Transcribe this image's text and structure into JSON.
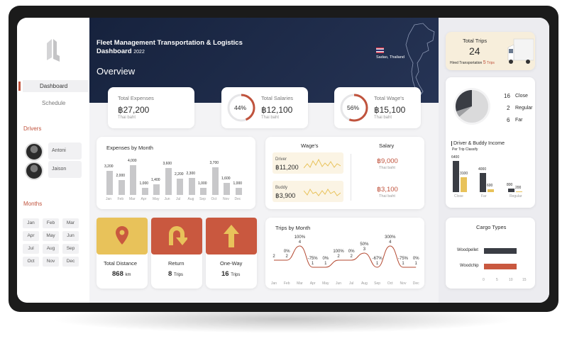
{
  "header": {
    "title": "Fleet Management Transportation & Logistics",
    "subtitle": "Dashboard",
    "year": "2022",
    "section": "Overview",
    "location": "Sadao, Thailand"
  },
  "nav": {
    "dashboard": "Dashboard",
    "schedule": "Schedule"
  },
  "drivers": {
    "title": "Drivers",
    "items": [
      "Antoni",
      "Jaison"
    ]
  },
  "months": {
    "title": "Months",
    "items": [
      "Jan",
      "Feb",
      "Mar",
      "Apr",
      "May",
      "Jun",
      "Jul",
      "Aug",
      "Sep",
      "Oct",
      "Nov",
      "Dec"
    ]
  },
  "kpi": {
    "expenses": {
      "label": "Total Expenses",
      "value": "฿27,200",
      "unit": "Thai baht"
    },
    "salaries": {
      "label": "Total Salaries",
      "value": "฿12,100",
      "unit": "Thai baht",
      "pct": "44%",
      "pct_value": 44
    },
    "wages": {
      "label": "Total Wage's",
      "value": "฿15,100",
      "unit": "Thai baht",
      "pct": "56%",
      "pct_value": 56
    }
  },
  "expenses_chart": {
    "title": "Expenses by Month",
    "categories": [
      "Jan",
      "Feb",
      "Mar",
      "Apr",
      "May",
      "Jun",
      "Jul",
      "Aug",
      "Sep",
      "Oct",
      "Nov",
      "Dec"
    ],
    "labels": [
      "3,200",
      "2,000",
      "4,000",
      "1,000",
      "1,400",
      "3,600",
      "2,200",
      "2,300",
      "1,000",
      "3,700",
      "1,600",
      "1,000"
    ],
    "values": [
      3200,
      2000,
      4000,
      1000,
      1400,
      3600,
      2200,
      2300,
      1000,
      3700,
      1600,
      1000
    ]
  },
  "wages_panel": {
    "wages_title": "Wage's",
    "salary_title": "Salary",
    "driver_label": "Driver",
    "driver_wage": "฿11,200",
    "driver_salary": "฿9,000",
    "buddy_label": "Buddy",
    "buddy_wage": "฿3,900",
    "buddy_salary": "฿3,100",
    "unit": "Thai baht"
  },
  "tiles": {
    "distance": {
      "label": "Total Distance",
      "value": "868",
      "unit": "km",
      "color": "#e8c25a",
      "icon": "map-pin-icon"
    },
    "return": {
      "label": "Return",
      "value": "8",
      "unit": "Trips",
      "color": "#c9583f",
      "icon": "u-turn-icon"
    },
    "oneway": {
      "label": "One-Way",
      "value": "16",
      "unit": "Trips",
      "color": "#c9583f",
      "icon": "arrow-up-icon"
    }
  },
  "chart_data": {
    "type": "line",
    "title": "Trips by Month",
    "categories": [
      "Jan",
      "Feb",
      "Mar",
      "Apr",
      "May",
      "Jun",
      "Jul",
      "Aug",
      "Sep",
      "Oct",
      "Nov",
      "Dec"
    ],
    "values": [
      2,
      2,
      4,
      1,
      1,
      2,
      2,
      3,
      1,
      4,
      1,
      1
    ],
    "pct_labels": [
      "",
      "0%",
      "100%",
      "-75%",
      "0%",
      "100%",
      "0%",
      "50%",
      "-67%",
      "300%",
      "-75%",
      "0%"
    ]
  },
  "total_trips": {
    "label": "Total Trips",
    "value": "24",
    "hired_label": "Hired Transportation",
    "hired_value": "5",
    "hired_unit": "Trips"
  },
  "classify_pie": {
    "items": [
      {
        "value": "16",
        "label": "Close"
      },
      {
        "value": "2",
        "label": "Regular"
      },
      {
        "value": "6",
        "label": "Far"
      }
    ]
  },
  "income": {
    "title": "Driver & Buddy Income",
    "subtitle": "Per Trip Classify",
    "categories": [
      "Close",
      "Far",
      "Regular"
    ],
    "driver_labels": [
      "6400",
      "4000",
      "800"
    ],
    "buddy_labels": [
      "3100",
      "600",
      "200"
    ],
    "driver_values": [
      6400,
      4000,
      800
    ],
    "buddy_values": [
      3100,
      600,
      200
    ]
  },
  "cargo": {
    "title": "Cargo Types",
    "items": [
      {
        "label": "Woodpellet",
        "value": 12
      },
      {
        "label": "Woodchip",
        "value": 12
      }
    ],
    "ticks": [
      "0",
      "5",
      "10",
      "15"
    ]
  },
  "colors": {
    "accent": "#c0533d",
    "yellow": "#e8c25a",
    "navy": "#16223d",
    "dark_bar": "#3a3d44"
  }
}
